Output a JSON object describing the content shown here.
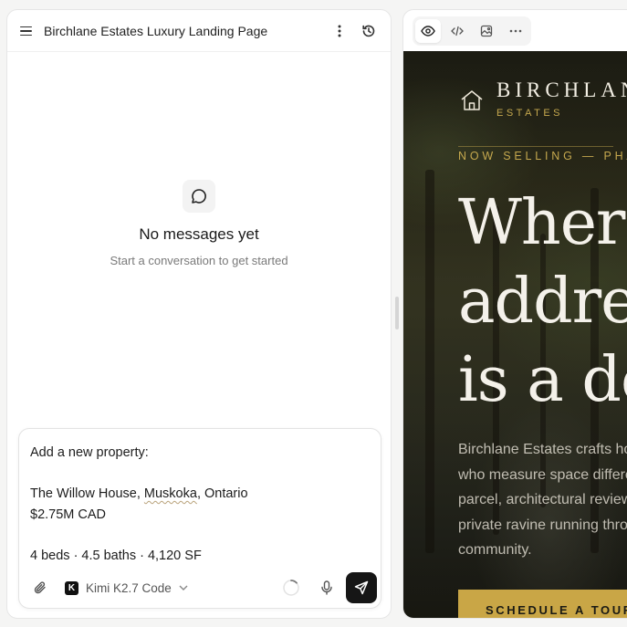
{
  "chat": {
    "title": "Birchlane Estates Luxury Landing Page",
    "empty_title": "No messages yet",
    "empty_subtitle": "Start a conversation to get started",
    "composer": {
      "lines": [
        "Add a new property:",
        "",
        "The Willow House, Muskoka, Ontario",
        "$2.75M CAD",
        "",
        "4 beds · 4.5 baths · 4,120 SF"
      ],
      "model": "Kimi K2.7 Code"
    }
  },
  "preview": {
    "brand_name": "BIRCHLANE",
    "brand_sub": "ESTATES",
    "eyebrow": "NOW SELLING — PHASE",
    "headline": [
      "Where",
      "address",
      "is a deed"
    ],
    "body": [
      "Birchlane Estates crafts homes for those",
      "who measure space differently. Every",
      "parcel, architectural review and",
      "private ravine running through the",
      "community."
    ],
    "cta": "SCHEDULE A TOUR"
  },
  "colors": {
    "accent_gold": "#c9a646",
    "send_button": "#161616"
  }
}
